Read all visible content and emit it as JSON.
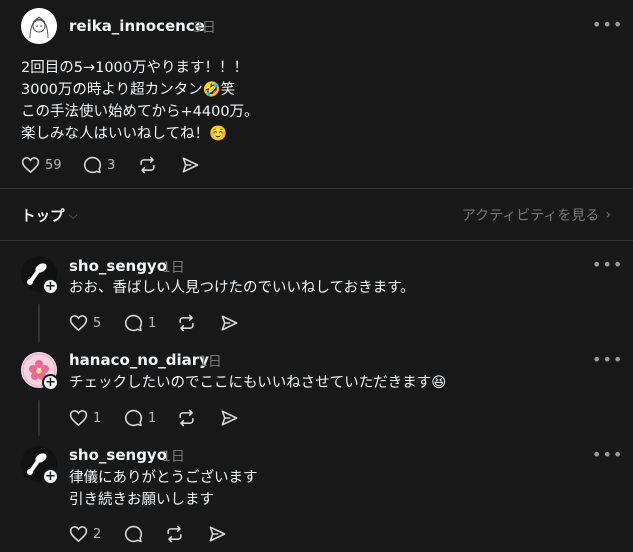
{
  "post": {
    "username": "reika_innocence",
    "time": "3日",
    "lines": [
      "2回目の5→1000万やります！！！",
      "3000万の時より超カンタン🤣笑",
      "この手法使い始めてから+4400万。",
      "楽しみな人はいいねしてね！☺️"
    ],
    "likes": "59",
    "comments": "3"
  },
  "sort": {
    "label": "トップ",
    "activity_label": "アクティビティを見る"
  },
  "replies": [
    {
      "username": "sho_sengyo",
      "time": "1日",
      "lines": [
        "おお、香ばしい人見つけたのでいいねしておきます。"
      ],
      "likes": "5",
      "comments": "1"
    },
    {
      "username": "hanaco_no_diary",
      "time": "1日",
      "lines": [
        "チェックしたいのでここにもいいねさせていただきます😆"
      ],
      "likes": "1",
      "comments": "1"
    },
    {
      "username": "sho_sengyo",
      "time": "1日",
      "lines": [
        "律儀にありがとうございます",
        "引き続きお願いします"
      ],
      "likes": "2",
      "comments": ""
    }
  ],
  "icons": {
    "like": "heart-icon",
    "comment": "comment-icon",
    "repost": "repost-icon",
    "share": "send-icon",
    "more": "more-icon"
  },
  "colors": {
    "background": "#181818",
    "text": "#f3f5f7",
    "muted": "#777777"
  }
}
